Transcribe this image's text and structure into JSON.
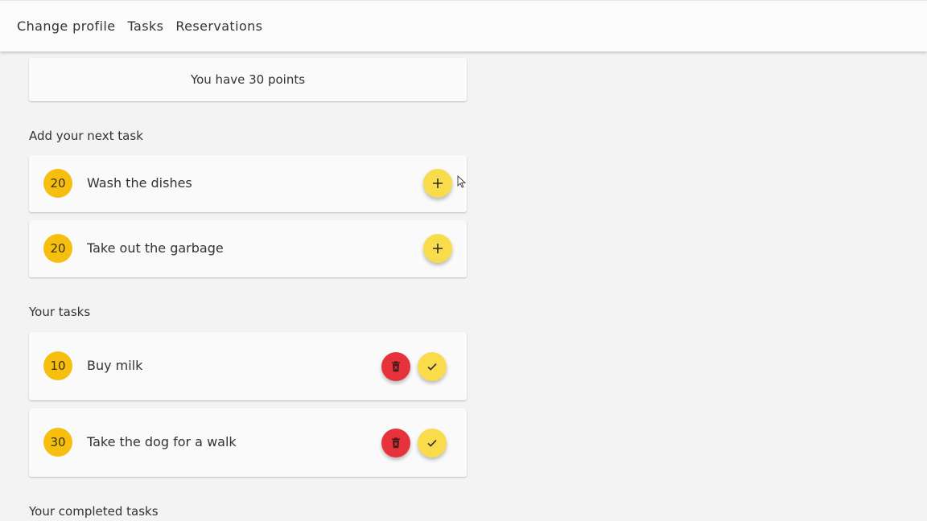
{
  "nav": {
    "items": [
      {
        "label": "Change profile"
      },
      {
        "label": "Tasks"
      },
      {
        "label": "Reservations"
      }
    ]
  },
  "points": {
    "text": "You have 30 points"
  },
  "sections": {
    "add_next": "Add your next task",
    "your_tasks": "Your tasks",
    "completed": "Your completed tasks"
  },
  "available_tasks": [
    {
      "points": "20",
      "title": "Wash the dishes",
      "action_icon": "plus-icon"
    },
    {
      "points": "20",
      "title": "Take out the garbage",
      "action_icon": "plus-icon"
    }
  ],
  "my_tasks": [
    {
      "points": "10",
      "title": "Buy milk",
      "actions": [
        "trash-icon",
        "check-icon"
      ]
    },
    {
      "points": "30",
      "title": "Take the dog for a walk",
      "actions": [
        "trash-icon",
        "check-icon"
      ]
    }
  ],
  "colors": {
    "points_badge": "#f6bf10",
    "fab_yellow": "#f9dc4b",
    "fab_red": "#e5323b",
    "background": "#f3f3f4"
  }
}
